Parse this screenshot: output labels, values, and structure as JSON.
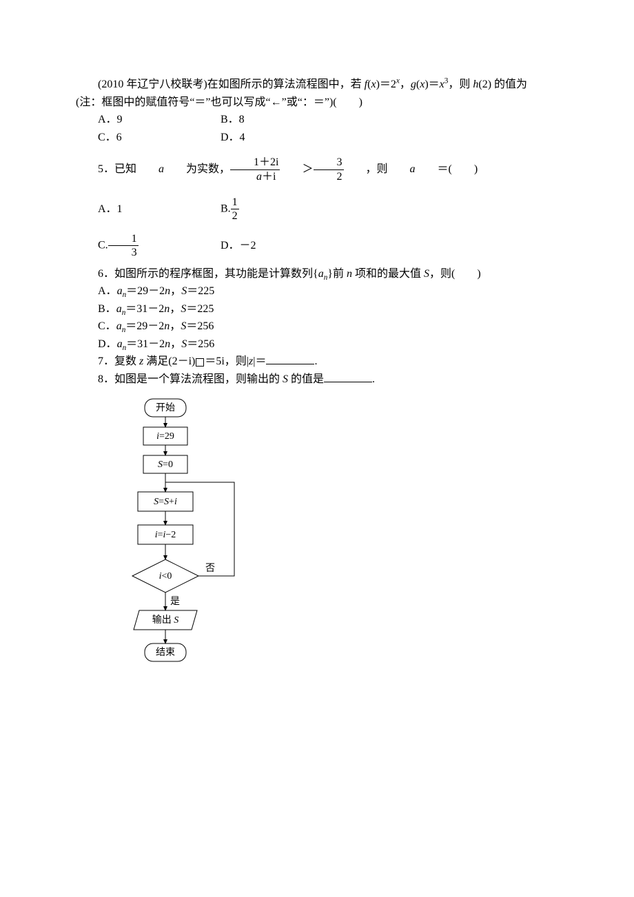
{
  "intro": {
    "line1a": "(2010 年辽宁八校联考)在如图所示的算法流程图中，若 ",
    "fx": "f",
    "x1": "x",
    "eq1": "＝2",
    "gx": "g",
    "x2": "x",
    "eq2": "＝",
    "x3": "x",
    "line1b": "，则 ",
    "hx": "h",
    "two": "2",
    "line1c": " 的值为",
    "line2": "(注：框图中的赋值符号“＝”也可以写成“←”或“：＝”)(　　)"
  },
  "introOpts": {
    "A": "A．9",
    "B": "B．8",
    "C": "C．6",
    "D": "D．4"
  },
  "q5": {
    "lead": "5．已知 ",
    "a": "a",
    "mid1": " 为实数，",
    "num": "1＋2i",
    "den_a": "a",
    "den_tail": "＋i",
    "gt": "＞",
    "r_num": "3",
    "r_den": "2",
    "mid2": "，则 ",
    "eq": "＝(　　)",
    "A": "A．1",
    "Bpre": "B.",
    "Bnum": "1",
    "Bden": "2",
    "Cpre": "C.",
    "Cnum": "1",
    "Cden": "3",
    "D": "D．－2"
  },
  "q6": {
    "text1": "6．如图所示的程序框图，其功能是计算数列{",
    "an": "a",
    "sub_n": "n",
    "text2": "}前 ",
    "n": "n",
    "text3": " 项和的最大值 ",
    "S": "S",
    "text4": "，则(　　)",
    "A1": "A．",
    "A_an": "a",
    "A_n": "n",
    "A_expr": "＝29－2",
    "A_nn": "n",
    "A_S": "，S",
    "A_val": "＝225",
    "B1": "B．",
    "B_expr": "＝31－2",
    "B_val": "＝225",
    "C1": "C．",
    "C_expr": "＝29－2",
    "C_val": "＝256",
    "D1": "D．",
    "D_expr": "＝31－2",
    "D_val": "＝256"
  },
  "q7": {
    "text1": "7．复数 ",
    "z": "z",
    "text2": " 满足(2－i)",
    "text3": "＝5i，则|",
    "z2": "z",
    "text4": "|＝",
    "tail": "."
  },
  "q8": {
    "text1": "8．如图是一个算法流程图，则输出的 ",
    "S": "S",
    "text2": " 的值是",
    "tail": "."
  },
  "flow": {
    "start": "开始",
    "i_init_i": "i",
    "i_init_v": "=29",
    "s_init_S": "S",
    "s_init_v": "=0",
    "s_upd_S1": "S",
    "s_upd_mid": "=",
    "s_upd_S2": "S",
    "s_upd_plus": "+",
    "s_upd_i": "i",
    "i_upd_i1": "i",
    "i_upd_mid": "=",
    "i_upd_i2": "i",
    "i_upd_m2": "−2",
    "cond_i": "i",
    "cond_rest": "<0",
    "no": "否",
    "yes": "是",
    "out": "输出 ",
    "out_S": "S",
    "end": "结束"
  }
}
